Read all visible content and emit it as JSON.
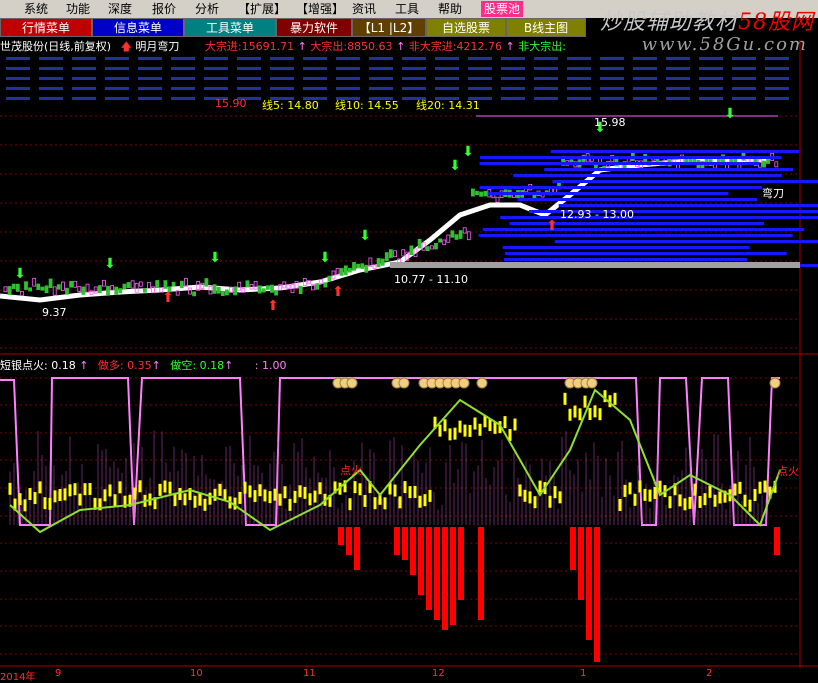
{
  "menu": [
    "系统",
    "功能",
    "深度",
    "报价",
    "分析",
    "【扩展】",
    "【增强】",
    "资讯",
    "工具",
    "帮助",
    "股票池"
  ],
  "toolbar": [
    "行情菜单",
    "信息菜单",
    "工具菜单",
    "暴力软件",
    "【L1 |L2】",
    "自选股票",
    "B线主图"
  ],
  "watermark": {
    "main": "炒股辅助教材",
    "site": "58股网",
    "url": "www.58Gu.com"
  },
  "title": {
    "stock": "世茂股份(日线,前复权)",
    "indicator": "明月弯刀",
    "inflow_label": "大宗进:",
    "inflow": "15691.71",
    "outflow_label": "大宗出:",
    "outflow": "8850.63",
    "non_inflow_label": "非大宗进:",
    "non_inflow": "4212.76",
    "non_outflow_label": "非大宗出:"
  },
  "ma": {
    "price": "15.90",
    "ma5": "线5: 14.80",
    "ma10": "线10: 14.55",
    "ma20": "线20: 14.31"
  },
  "main_labels": {
    "high": "15.98",
    "low": "9.37",
    "band1": "12.93 - 13.00",
    "band2": "10.77 - 11.10",
    "curve": "弯刀"
  },
  "sub": {
    "name": "短银点火",
    "name_val": ": 0.18",
    "long_label": "做多:",
    "long_val": "0.35",
    "short_label": "做空:",
    "short_val": "0.18",
    "extra": ": 1.00",
    "fire_text": "点火"
  },
  "time_axis": [
    "2014年",
    "9",
    "10",
    "11",
    "12",
    "1",
    "2"
  ],
  "colors": {
    "up": "#ff3030",
    "down": "#30ff30",
    "grid": "#800000",
    "pink": "#ff80ff",
    "yellow": "#ffff00",
    "blue": "#1818ff"
  }
}
